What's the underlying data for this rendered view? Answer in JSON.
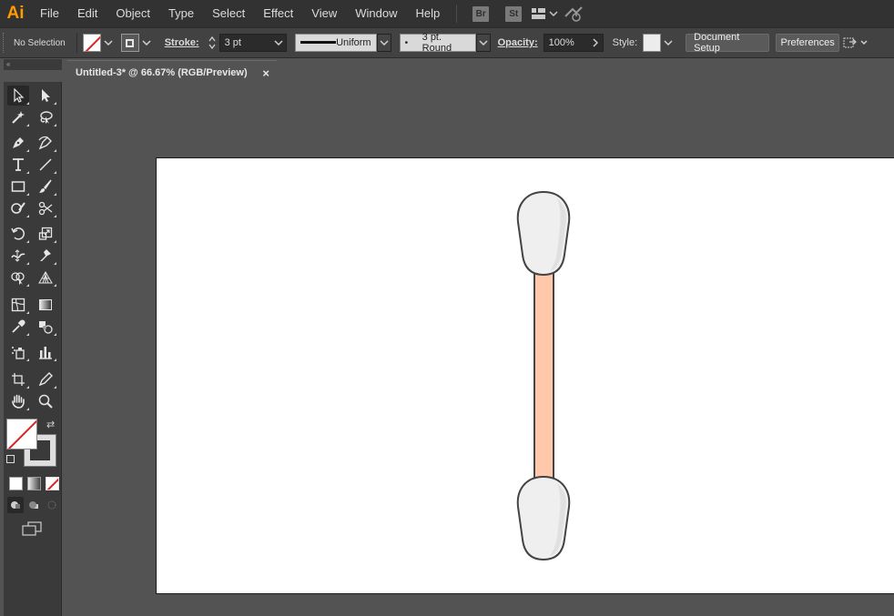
{
  "app": {
    "logo": "Ai",
    "accent_color": "#ff9a00"
  },
  "menu": {
    "items": [
      "File",
      "Edit",
      "Object",
      "Type",
      "Select",
      "Effect",
      "View",
      "Window",
      "Help"
    ],
    "bridge_label": "Br",
    "stock_label": "St"
  },
  "controlbar": {
    "selection_status": "No Selection",
    "stroke_label": "Stroke:",
    "stroke_weight": "3 pt",
    "variable_width_profile": "Uniform",
    "brush": "3 pt. Round",
    "opacity_label": "Opacity:",
    "opacity_value": "100%",
    "style_label": "Style:",
    "document_setup": "Document Setup",
    "preferences": "Preferences"
  },
  "document": {
    "tab_title": "Untitled-3* @ 66.67% (RGB/Preview)",
    "close_glyph": "×"
  },
  "artwork": {
    "stick_color": "#ffc8aa",
    "tip_color": "#efefef",
    "outline_color": "#444444"
  },
  "icons": {
    "collapse": "«",
    "swap": "⇄"
  }
}
